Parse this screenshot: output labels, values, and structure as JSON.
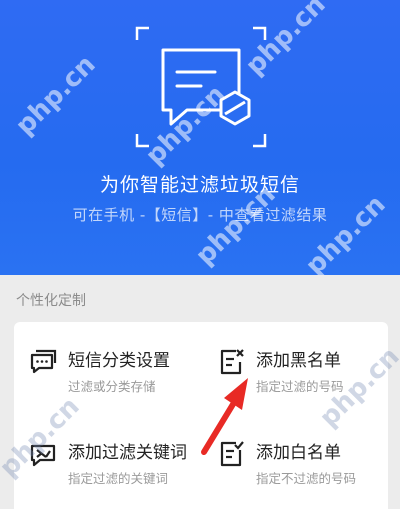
{
  "hero": {
    "title": "为你智能过滤垃圾短信",
    "subtitle": "可在手机 -【短信】- 中查看过滤结果"
  },
  "section": {
    "label": "个性化定制"
  },
  "items": [
    {
      "title": "短信分类设置",
      "subtitle": "过滤或分类存储",
      "icon": "message-settings-icon"
    },
    {
      "title": "添加黑名单",
      "subtitle": "指定过滤的号码",
      "icon": "blacklist-icon"
    },
    {
      "title": "添加过滤关键词",
      "subtitle": "指定过滤的关键词",
      "icon": "filter-keyword-icon"
    },
    {
      "title": "添加白名单",
      "subtitle": "指定不过滤的号码",
      "icon": "whitelist-icon"
    }
  ],
  "watermark": "php.cn",
  "colors": {
    "brand_blue": "#2a6df2",
    "arrow_red": "#e82a25"
  }
}
